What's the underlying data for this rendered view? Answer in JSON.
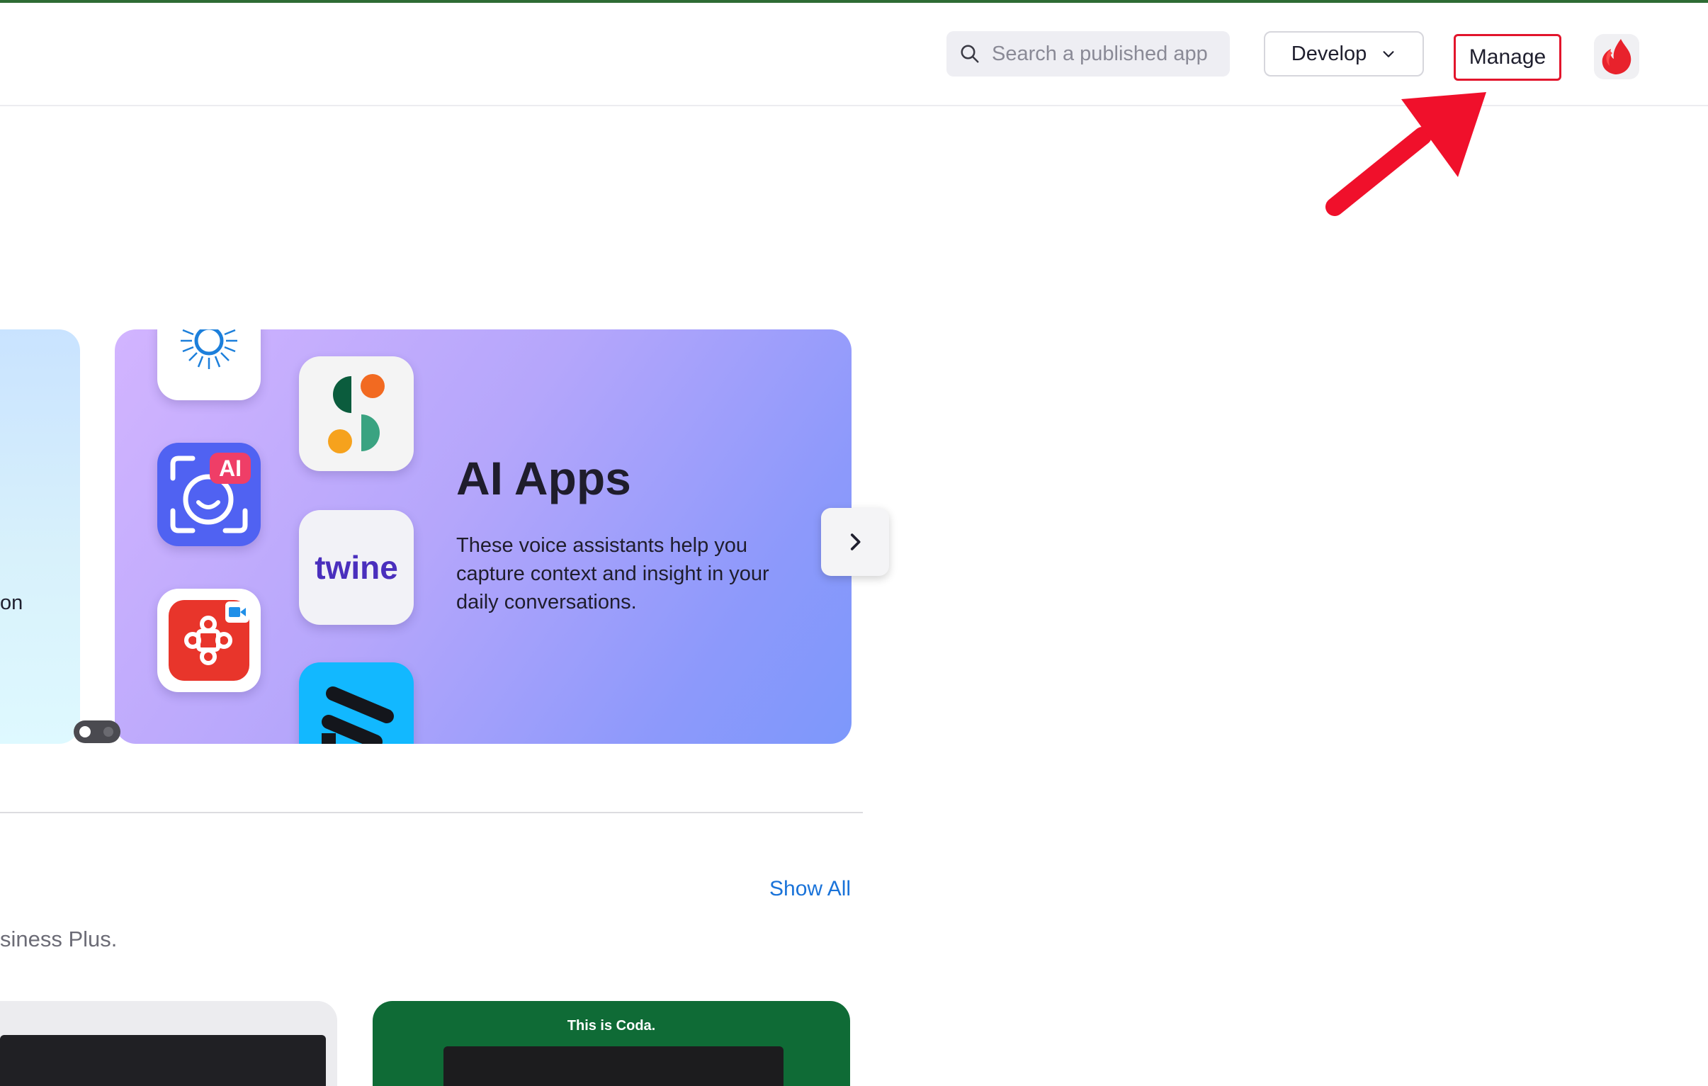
{
  "header": {
    "search_placeholder": "Search a published app",
    "develop_label": "Develop",
    "manage_label": "Manage"
  },
  "carousel": {
    "prev_card_text_fragment": "on",
    "featured": {
      "title": "AI Apps",
      "description": "These voice assistants help you capture context and insight in your daily conversations.",
      "icons": [
        "sunburst-app-icon",
        "ai-camera-app-icon",
        "video-collab-app-icon",
        "s-dots-app-icon",
        "twine-app-icon",
        "stripes-app-icon"
      ],
      "twine_logo_text": "twine",
      "ai_badge_text": "AI"
    }
  },
  "section": {
    "show_all_label": "Show All",
    "subtitle_fragment": "siness Plus."
  },
  "thumbnails": {
    "second_caption": "This is Coda."
  },
  "colors": {
    "accent_link": "#1a73d9",
    "highlight_red": "#e2152c",
    "top_bar_green": "#2e6b34",
    "ai_gradient_start": "#d2b4ff",
    "ai_gradient_end": "#7d98fb"
  }
}
